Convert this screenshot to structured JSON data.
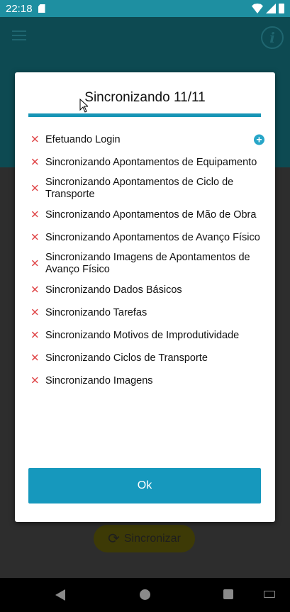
{
  "statusbar": {
    "time": "22:18"
  },
  "background": {
    "sync_button_label": "Sincronizar"
  },
  "dialog": {
    "title": "Sincronizando 11/11",
    "items": [
      {
        "label": "Efetuando Login",
        "status": "error",
        "expand": true
      },
      {
        "label": "Sincronizando Apontamentos de Equipamento",
        "status": "error"
      },
      {
        "label": "Sincronizando Apontamentos de Ciclo de Transporte",
        "status": "error"
      },
      {
        "label": "Sincronizando Apontamentos de Mão de Obra",
        "status": "error"
      },
      {
        "label": "Sincronizando Apontamentos de Avanço Físico",
        "status": "error"
      },
      {
        "label": "Sincronizando Imagens de Apontamentos de Avanço Físico",
        "status": "error"
      },
      {
        "label": "Sincronizando Dados Básicos",
        "status": "error"
      },
      {
        "label": "Sincronizando Tarefas",
        "status": "error"
      },
      {
        "label": "Sincronizando Motivos de Improdutividade",
        "status": "error"
      },
      {
        "label": "Sincronizando Ciclos de Transporte",
        "status": "error"
      },
      {
        "label": "Sincronizando Imagens",
        "status": "error"
      }
    ],
    "ok_label": "Ok"
  },
  "colors": {
    "accent": "#1698bd",
    "error": "#e0494b",
    "statusbar": "#1e8fa1"
  }
}
